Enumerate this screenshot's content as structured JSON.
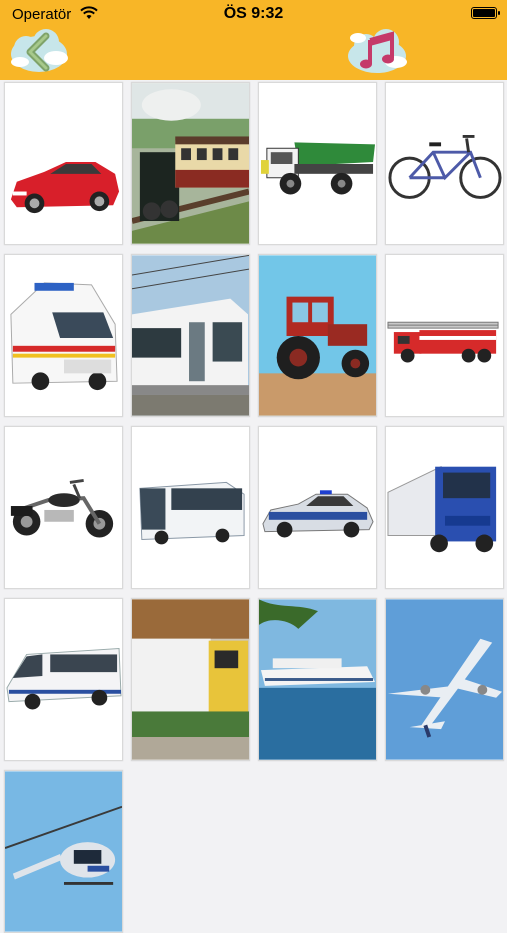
{
  "status_bar": {
    "carrier": "Operatör",
    "time": "ÖS 9:32"
  },
  "header": {
    "back_icon": "back-arrow-icon",
    "music_icon": "music-note-icon"
  },
  "colors": {
    "header_yellow": "#f8b627",
    "music_note": "#c53a6a",
    "back_arrow": "#6b8f2a"
  },
  "vehicles": [
    {
      "name": "sports-car",
      "icon": "red-car"
    },
    {
      "name": "steam-train",
      "icon": "train"
    },
    {
      "name": "dump-truck",
      "icon": "green-truck"
    },
    {
      "name": "bicycle",
      "icon": "bicycle"
    },
    {
      "name": "ambulance",
      "icon": "ambulance"
    },
    {
      "name": "tram",
      "icon": "tram"
    },
    {
      "name": "tractor",
      "icon": "tractor"
    },
    {
      "name": "fire-truck",
      "icon": "fire-truck"
    },
    {
      "name": "motorcycle",
      "icon": "motorcycle"
    },
    {
      "name": "bus",
      "icon": "bus"
    },
    {
      "name": "police-car",
      "icon": "police-car"
    },
    {
      "name": "lorry",
      "icon": "blue-lorry"
    },
    {
      "name": "minibus",
      "icon": "minibus"
    },
    {
      "name": "garbage-truck",
      "icon": "garbage-truck"
    },
    {
      "name": "cruise-ship",
      "icon": "ship"
    },
    {
      "name": "airplane",
      "icon": "airplane"
    },
    {
      "name": "helicopter",
      "icon": "helicopter"
    }
  ]
}
